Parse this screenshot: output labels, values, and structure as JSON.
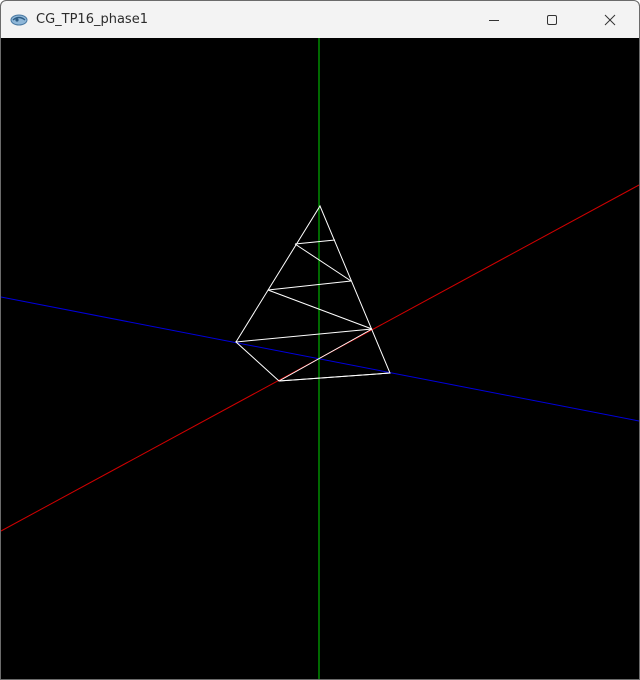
{
  "window": {
    "title": "CG_TP16_phase1",
    "controls": [
      "minimize",
      "maximize",
      "close"
    ],
    "app_icon": "opengl-app-icon"
  },
  "scene": {
    "background_color": "#000000",
    "axes": [
      {
        "name": "x-axis",
        "color": "#cc0000"
      },
      {
        "name": "y-axis",
        "color": "#00cc00"
      },
      {
        "name": "z-axis",
        "color": "#0000cc"
      }
    ],
    "model": {
      "type": "wireframe-cone",
      "color": "#ffffff"
    }
  }
}
